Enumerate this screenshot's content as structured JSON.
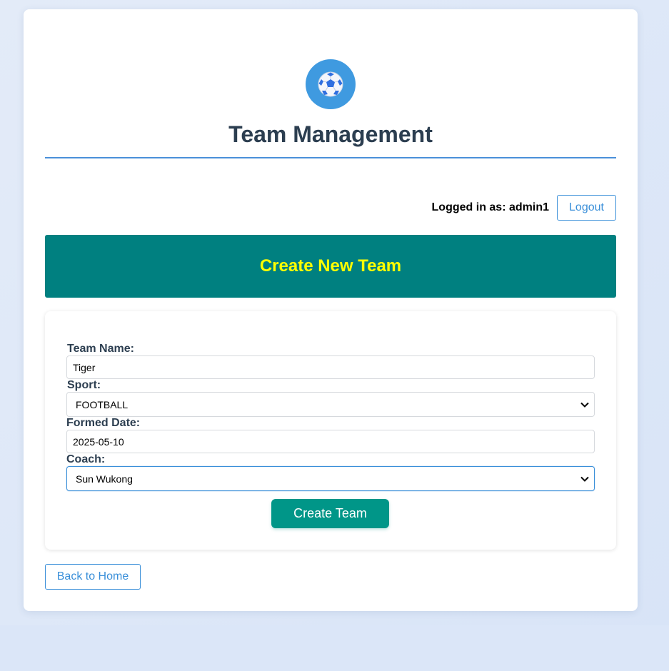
{
  "header": {
    "title": "Team Management",
    "logo_icon": "soccer-ball-icon"
  },
  "session": {
    "logged_in_text": "Logged in as: admin1",
    "logout_label": "Logout"
  },
  "banner": {
    "title": "Create New Team"
  },
  "form": {
    "team_name_label": "Team Name:",
    "team_name_value": "Tiger",
    "sport_label": "Sport:",
    "sport_value": "FOOTBALL",
    "formed_date_label": "Formed Date:",
    "formed_date_value": "2025-05-10",
    "coach_label": "Coach:",
    "coach_value": "Sun Wukong",
    "submit_label": "Create Team"
  },
  "footer": {
    "back_label": "Back to Home"
  },
  "colors": {
    "banner_bg": "#008080",
    "banner_text": "#ffff00",
    "accent_blue": "#3a8fd9",
    "submit_bg": "#009688",
    "heading_text": "#2c3e50"
  }
}
